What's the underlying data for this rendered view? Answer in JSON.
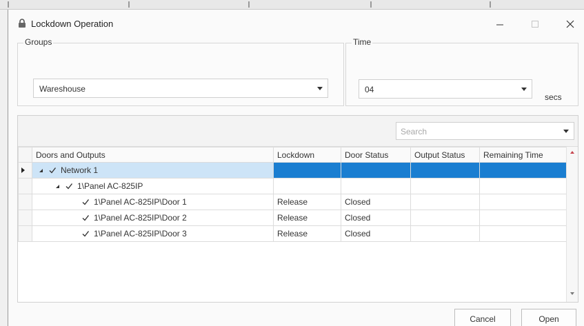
{
  "window": {
    "title": "Lockdown Operation",
    "icons": {
      "title": "lock-icon",
      "minimize": "minimize-icon",
      "maximize": "maximize-icon",
      "close": "close-icon"
    }
  },
  "groups": {
    "legend": "Groups",
    "selected": "Wareshouse"
  },
  "time": {
    "legend": "Time",
    "selected": "04",
    "unit": "secs"
  },
  "search": {
    "placeholder": "Search"
  },
  "table": {
    "columns": [
      "Doors and Outputs",
      "Lockdown",
      "Door Status",
      "Output Status",
      "Remaining Time"
    ],
    "rows": [
      {
        "name": "Network 1",
        "lockdown": "",
        "door_status": "",
        "output_status": "",
        "remaining_time": "",
        "level": 0,
        "expandable": true,
        "checked": true,
        "selected": true
      },
      {
        "name": "1\\Panel AC-825IP",
        "lockdown": "",
        "door_status": "",
        "output_status": "",
        "remaining_time": "",
        "level": 1,
        "expandable": true,
        "checked": true,
        "selected": false
      },
      {
        "name": "1\\Panel AC-825IP\\Door 1",
        "lockdown": "Release",
        "door_status": "Closed",
        "output_status": "",
        "remaining_time": "",
        "level": 2,
        "expandable": false,
        "checked": true,
        "selected": false
      },
      {
        "name": "1\\Panel AC-825IP\\Door 2",
        "lockdown": "Release",
        "door_status": "Closed",
        "output_status": "",
        "remaining_time": "",
        "level": 2,
        "expandable": false,
        "checked": true,
        "selected": false
      },
      {
        "name": "1\\Panel AC-825IP\\Door 3",
        "lockdown": "Release",
        "door_status": "Closed",
        "output_status": "",
        "remaining_time": "",
        "level": 2,
        "expandable": false,
        "checked": true,
        "selected": false
      }
    ]
  },
  "buttons": {
    "cancel": "Cancel",
    "open": "Open"
  },
  "colors": {
    "selection_blue": "#1a7ed1",
    "selection_light": "#cde4f7"
  }
}
